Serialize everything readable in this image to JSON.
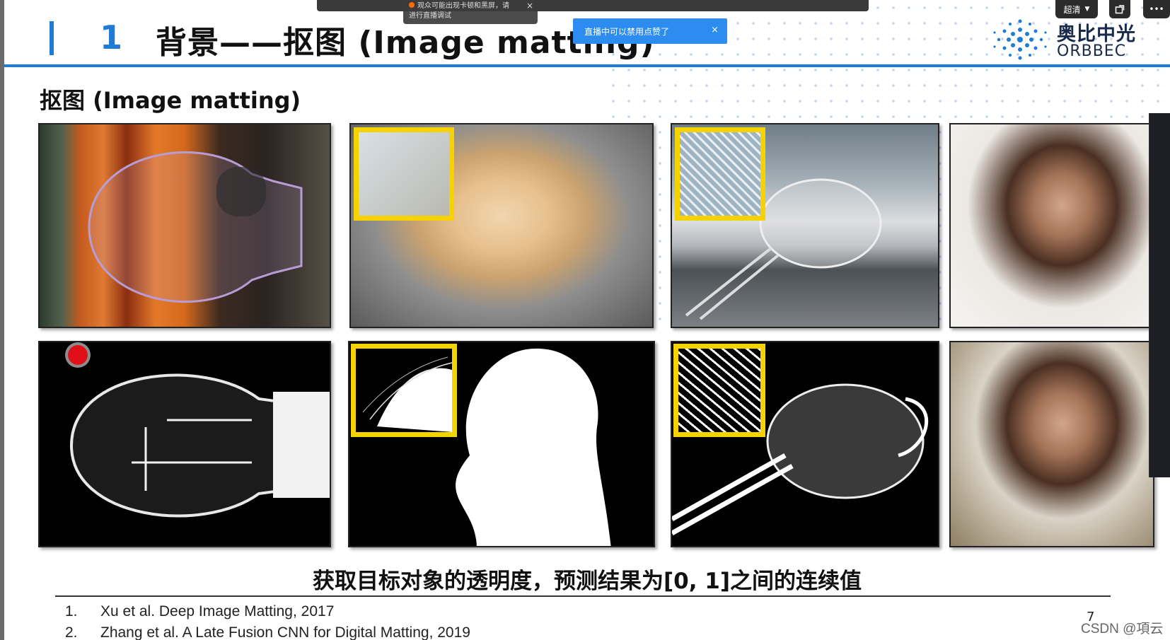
{
  "slide": {
    "section_number": "1",
    "title": "背景——抠图 (Image matting)",
    "subtitle": "抠图 (Image matting)",
    "caption": "获取目标对象的透明度，预测结果为[0, 1]之间的连续值",
    "page_number": "7"
  },
  "logo": {
    "cn": "奥比中光",
    "en": "ORBBEC"
  },
  "references": [
    {
      "n": "1.",
      "text": "Xu et al. Deep Image Matting, 2017"
    },
    {
      "n": "2.",
      "text": "Zhang et al. A Late Fusion CNN for Digital Matting, 2019"
    }
  ],
  "overlay": {
    "tooltip_line1": "观众可能出现卡顿和黑屏，请",
    "tooltip_line2": "进行直播调试",
    "toast": "直播中可以禁用点赞了",
    "quality_label": "超清",
    "more_label": "•••",
    "close_glyph": "×"
  },
  "watermark": "CSDN @項云",
  "colors": {
    "accent": "#1e7bd6",
    "inset_border": "#f5d200",
    "toast_bg": "#2d8cf0"
  }
}
